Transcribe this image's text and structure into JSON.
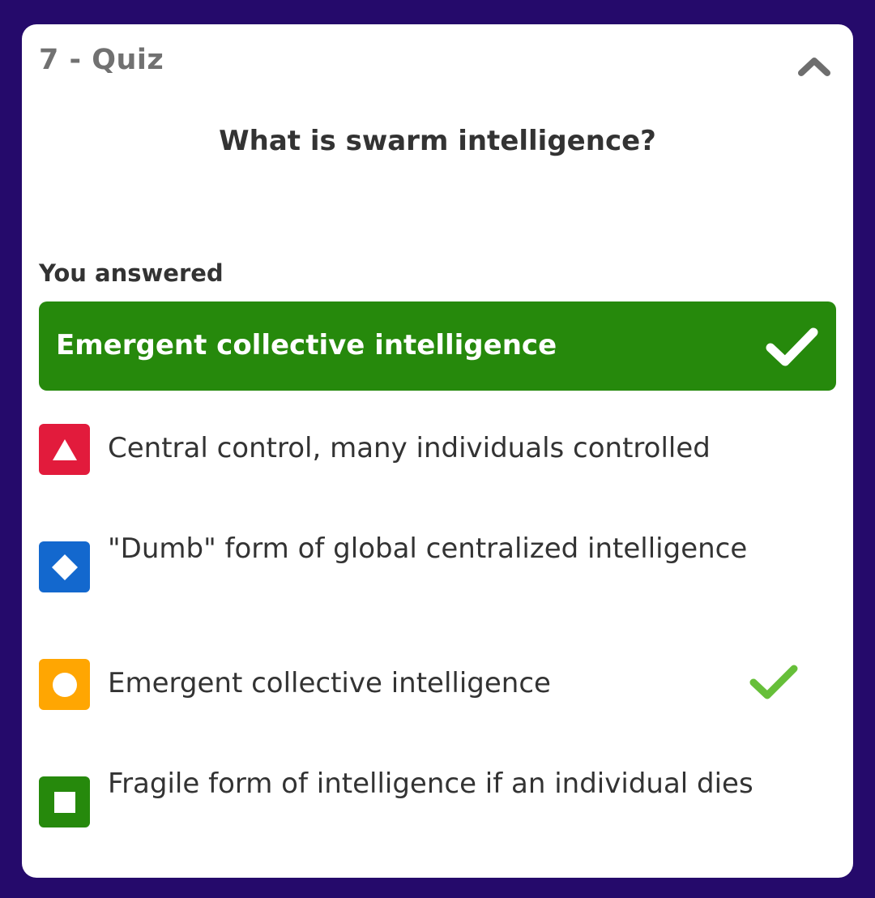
{
  "quiz": {
    "header_title": "7 - Quiz",
    "question": "What is swarm intelligence?",
    "you_answered_label": "You answered",
    "selected_answer": "Emergent collective intelligence",
    "collapse_icon": "chevron-up-icon",
    "options": [
      {
        "shape": "triangle",
        "color": "#e21b3c",
        "text": "Central control, many individuals controlled",
        "correct": false
      },
      {
        "shape": "diamond",
        "color": "#1368ce",
        "text": "\"Dumb\" form of global centralized intelligence",
        "correct": false
      },
      {
        "shape": "circle",
        "color": "#ffa602",
        "text": "Emergent collective intelligence",
        "correct": true
      },
      {
        "shape": "square",
        "color": "#26890c",
        "text": "Fragile form of intelligence if an individual dies",
        "correct": false
      }
    ]
  },
  "colors": {
    "background": "#250a6b",
    "card": "#ffffff",
    "correct_green": "#26890c",
    "check_green": "#66bf39"
  }
}
